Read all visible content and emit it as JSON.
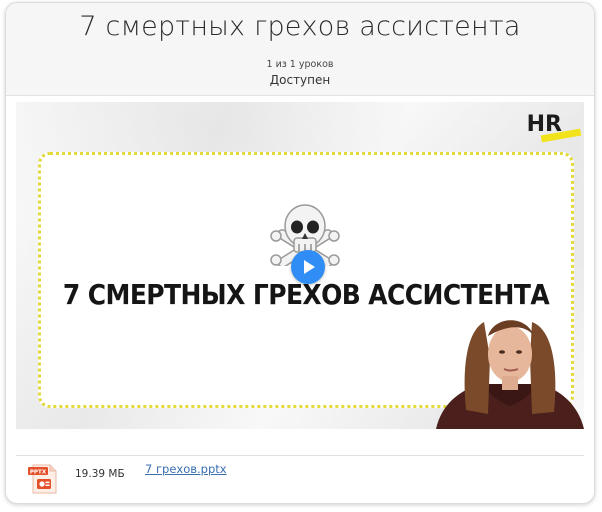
{
  "lesson": {
    "title": "7 смертных грехов ассистента",
    "counter": "1 из 1 уроков",
    "status": "Доступен"
  },
  "video": {
    "logo_text": "HR",
    "title_text": "7 СМЕРТНЫХ ГРЕХОВ АССИСТЕНТА",
    "skull_icon": "skull-and-crossbones-icon",
    "play_icon": "play-icon",
    "accent_color": "#2f8df5",
    "frame_color": "#e2d93a"
  },
  "attachment": {
    "type_badge": "PPTX",
    "size": "19.39 МБ",
    "file_name": "7 грехов.pptx"
  }
}
